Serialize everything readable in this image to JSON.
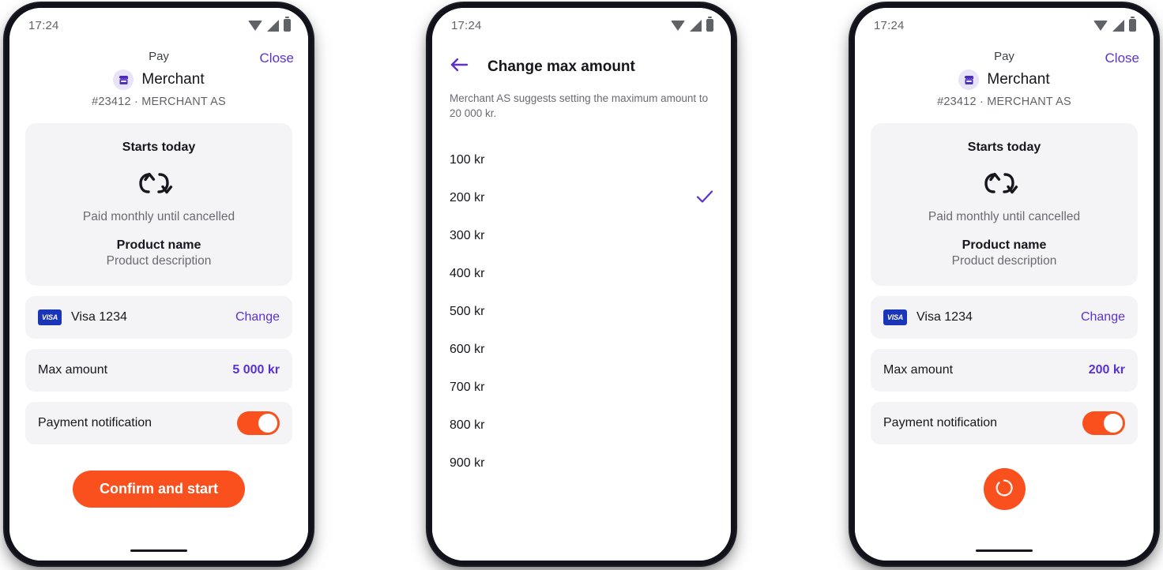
{
  "theme": {
    "accent_orange": "#F9501D",
    "accent_purple": "#5B32D0",
    "card_bg": "#F4F4F6",
    "visa_blue": "#1A35B8",
    "text_dark": "#16161D",
    "text_muted": "#6A6A73"
  },
  "status_bar": {
    "time": "17:24",
    "icons": [
      "wifi-icon",
      "signal-icon",
      "battery-icon"
    ]
  },
  "phone1": {
    "header": {
      "pay_label": "Pay",
      "close_label": "Close",
      "merchant_icon": "store-icon",
      "merchant_name": "Merchant",
      "merchant_sub": "#23412 · MERCHANT AS"
    },
    "summary": {
      "starts": "Starts today",
      "recurring_icon": "sync-recurring-icon",
      "frequency": "Paid monthly until cancelled",
      "product_name": "Product name",
      "product_description": "Product description"
    },
    "card_row": {
      "brand_icon": "visa-logo-icon",
      "brand_text": "VISA",
      "label": "Visa 1234",
      "action": "Change"
    },
    "max_amount_row": {
      "label": "Max amount",
      "value": "5 000 kr"
    },
    "notification_row": {
      "label": "Payment notification",
      "toggle_state": "on"
    },
    "cta": {
      "label": "Confirm and start"
    }
  },
  "phone2": {
    "header": {
      "back_icon": "arrow-left-icon",
      "title": "Change max amount"
    },
    "description": "Merchant AS suggests setting the maximum amount to 20 000 kr.",
    "selected_amount": "200 kr",
    "check_icon": "check-icon",
    "amounts": [
      "100 kr",
      "200 kr",
      "300 kr",
      "400 kr",
      "500 kr",
      "600 kr",
      "700 kr",
      "800 kr",
      "900 kr"
    ]
  },
  "phone3": {
    "header": {
      "pay_label": "Pay",
      "close_label": "Close",
      "merchant_icon": "store-icon",
      "merchant_name": "Merchant",
      "merchant_sub": "#23412 · MERCHANT AS"
    },
    "summary": {
      "starts": "Starts today",
      "recurring_icon": "sync-recurring-icon",
      "frequency": "Paid monthly until cancelled",
      "product_name": "Product name",
      "product_description": "Product description"
    },
    "card_row": {
      "brand_icon": "visa-logo-icon",
      "brand_text": "VISA",
      "label": "Visa 1234",
      "action": "Change"
    },
    "max_amount_row": {
      "label": "Max amount",
      "value": "200 kr"
    },
    "notification_row": {
      "label": "Payment notification",
      "toggle_state": "on"
    },
    "cta": {
      "state": "loading",
      "icon": "loading-spinner-icon"
    }
  }
}
